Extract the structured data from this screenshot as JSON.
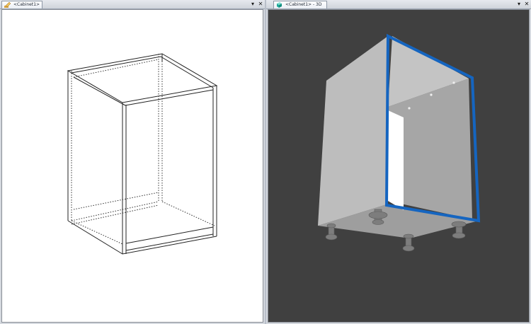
{
  "left_panel": {
    "tab_label": "<Cabinet1>",
    "dropdown_glyph": "▾",
    "close_glyph": "✕",
    "tab_icon": "pencil-icon",
    "view": "wireframe"
  },
  "right_panel": {
    "tab_label": "<Cabinet1> - 3D",
    "dropdown_glyph": "▾",
    "close_glyph": "✕",
    "tab_icon": "cube-icon",
    "view": "3d",
    "background_color": "#404040",
    "selection_color": "#1565c0"
  }
}
